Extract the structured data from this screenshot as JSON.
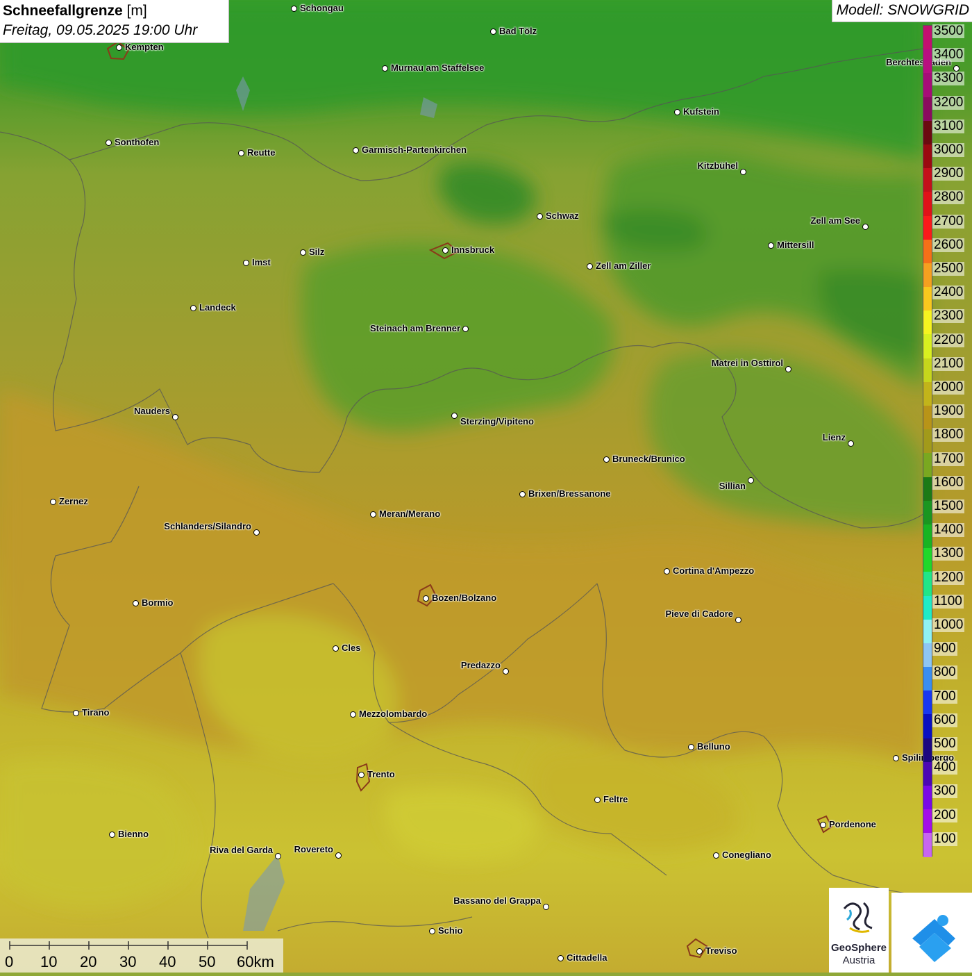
{
  "title": {
    "main": "Schneefallgrenze",
    "unit": "[m]",
    "datetime": "Freitag, 09.05.2025 19:00 Uhr"
  },
  "model": "Modell: SNOWGRID",
  "legend": {
    "items": [
      {
        "label": "3500",
        "color": "#c21070"
      },
      {
        "label": "3400",
        "color": "#b80f80"
      },
      {
        "label": "3300",
        "color": "#a60d77"
      },
      {
        "label": "3200",
        "color": "#8a0c5e"
      },
      {
        "label": "3100",
        "color": "#6b0a10"
      },
      {
        "label": "3000",
        "color": "#9a0a10"
      },
      {
        "label": "2900",
        "color": "#c4101a"
      },
      {
        "label": "2800",
        "color": "#e01218"
      },
      {
        "label": "2700",
        "color": "#fb1a1a"
      },
      {
        "label": "2600",
        "color": "#f57018"
      },
      {
        "label": "2500",
        "color": "#f5a020"
      },
      {
        "label": "2400",
        "color": "#f8c81e"
      },
      {
        "label": "2300",
        "color": "#f6f420"
      },
      {
        "label": "2200",
        "color": "#d8f020"
      },
      {
        "label": "2100",
        "color": "#c6d61c"
      },
      {
        "label": "2000",
        "color": "#c2b41a"
      },
      {
        "label": "1900",
        "color": "#b89418"
      },
      {
        "label": "1800",
        "color": "#a29a1a"
      },
      {
        "label": "1700",
        "color": "#7aa820"
      },
      {
        "label": "1600",
        "color": "#1c7a16"
      },
      {
        "label": "1500",
        "color": "#1a9620"
      },
      {
        "label": "1400",
        "color": "#18b422"
      },
      {
        "label": "1300",
        "color": "#20d82a"
      },
      {
        "label": "1200",
        "color": "#20e688"
      },
      {
        "label": "1100",
        "color": "#20ecc6"
      },
      {
        "label": "1000",
        "color": "#90f2f2"
      },
      {
        "label": "900",
        "color": "#8ec6f2"
      },
      {
        "label": "800",
        "color": "#3a8ef0"
      },
      {
        "label": "700",
        "color": "#1838f0"
      },
      {
        "label": "600",
        "color": "#0a10c0"
      },
      {
        "label": "500",
        "color": "#1c0880"
      },
      {
        "label": "400",
        "color": "#4c08b4"
      },
      {
        "label": "300",
        "color": "#7a0ae6"
      },
      {
        "label": "200",
        "color": "#a40ee8"
      },
      {
        "label": "100",
        "color": "#c866f0"
      }
    ]
  },
  "cities": [
    {
      "name": "Schongau"
    },
    {
      "name": "Kempten"
    },
    {
      "name": "Bad Tölz"
    },
    {
      "name": "Murnau am Staffelsee"
    },
    {
      "name": "Berchtesgaden"
    },
    {
      "name": "Kufstein"
    },
    {
      "name": "Sonthofen"
    },
    {
      "name": "Reutte"
    },
    {
      "name": "Garmisch-Partenkirchen"
    },
    {
      "name": "Kitzbühel"
    },
    {
      "name": "Schwaz"
    },
    {
      "name": "Zell am See"
    },
    {
      "name": "Innsbruck"
    },
    {
      "name": "Mittersill"
    },
    {
      "name": "Imst"
    },
    {
      "name": "Silz"
    },
    {
      "name": "Zell am Ziller"
    },
    {
      "name": "Landeck"
    },
    {
      "name": "Steinach am Brenner"
    },
    {
      "name": "Matrei in Osttirol"
    },
    {
      "name": "Nauders"
    },
    {
      "name": "Sterzing/Vipiteno"
    },
    {
      "name": "Lienz"
    },
    {
      "name": "Bruneck/Brunico"
    },
    {
      "name": "Sillian"
    },
    {
      "name": "Zernez"
    },
    {
      "name": "Brixen/Bressanone"
    },
    {
      "name": "Meran/Merano"
    },
    {
      "name": "Schlanders/Silandro"
    },
    {
      "name": "Cortina d'Ampezzo"
    },
    {
      "name": "Bormio"
    },
    {
      "name": "Bozen/Bolzano"
    },
    {
      "name": "Pieve di Cadore"
    },
    {
      "name": "Cles"
    },
    {
      "name": "Predazzo"
    },
    {
      "name": "Tirano"
    },
    {
      "name": "Mezzolombardo"
    },
    {
      "name": "Belluno"
    },
    {
      "name": "Spilimbergo"
    },
    {
      "name": "Trento"
    },
    {
      "name": "Feltre"
    },
    {
      "name": "Bienno"
    },
    {
      "name": "Pordenone"
    },
    {
      "name": "Riva del Garda"
    },
    {
      "name": "Rovereto"
    },
    {
      "name": "Conegliano"
    },
    {
      "name": "Bassano del Grappa"
    },
    {
      "name": "Schio"
    },
    {
      "name": "Treviso"
    },
    {
      "name": "Cittadella"
    }
  ],
  "scale": {
    "labels": [
      "0",
      "10",
      "20",
      "30",
      "40",
      "50",
      "60km"
    ]
  },
  "logo": {
    "name": "GeoSphere",
    "sub": "Austria"
  }
}
